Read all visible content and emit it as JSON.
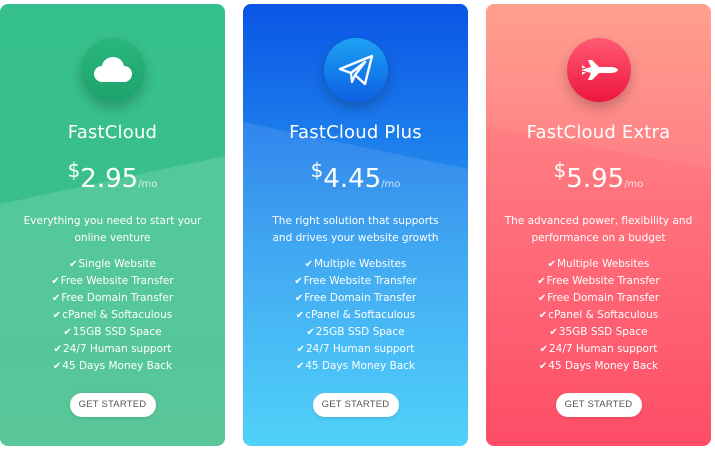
{
  "colors": {
    "green_card": "#3dbd89",
    "blue_card": "#2b9df0",
    "red_card": "#fe6679",
    "button_bg": "#ffffff",
    "button_text": "#555555"
  },
  "plans": [
    {
      "name": "FastCloud",
      "icon": "cloud-icon",
      "currency": "$",
      "price": "2.95",
      "period": "/mo",
      "description": "Everything you need to start your online venture",
      "features": [
        "Single Website",
        "Free Website Transfer",
        "Free Domain Transfer",
        "cPanel & Softaculous",
        "15GB SSD Space",
        "24/7 Human support",
        "45 Days Money Back"
      ],
      "cta": "GET STARTED"
    },
    {
      "name": "FastCloud Plus",
      "icon": "paper-plane-icon",
      "currency": "$",
      "price": "4.45",
      "period": "/mo",
      "description": "The right solution that supports and drives your website growth",
      "features": [
        "Multiple Websites",
        "Free Website Transfer",
        "Free Domain Transfer",
        "cPanel & Softaculous",
        "25GB SSD Space",
        "24/7 Human support",
        "45 Days Money Back"
      ],
      "cta": "GET STARTED"
    },
    {
      "name": "FastCloud Extra",
      "icon": "jet-icon",
      "currency": "$",
      "price": "5.95",
      "period": "/mo",
      "description": "The advanced power, flexibility and performance on a budget",
      "features": [
        "Multiple Websites",
        "Free Website Transfer",
        "Free Domain Transfer",
        "cPanel & Softaculous",
        "35GB SSD Space",
        "24/7 Human support",
        "45 Days Money Back"
      ],
      "cta": "GET STARTED"
    }
  ],
  "check_glyph": "✔"
}
